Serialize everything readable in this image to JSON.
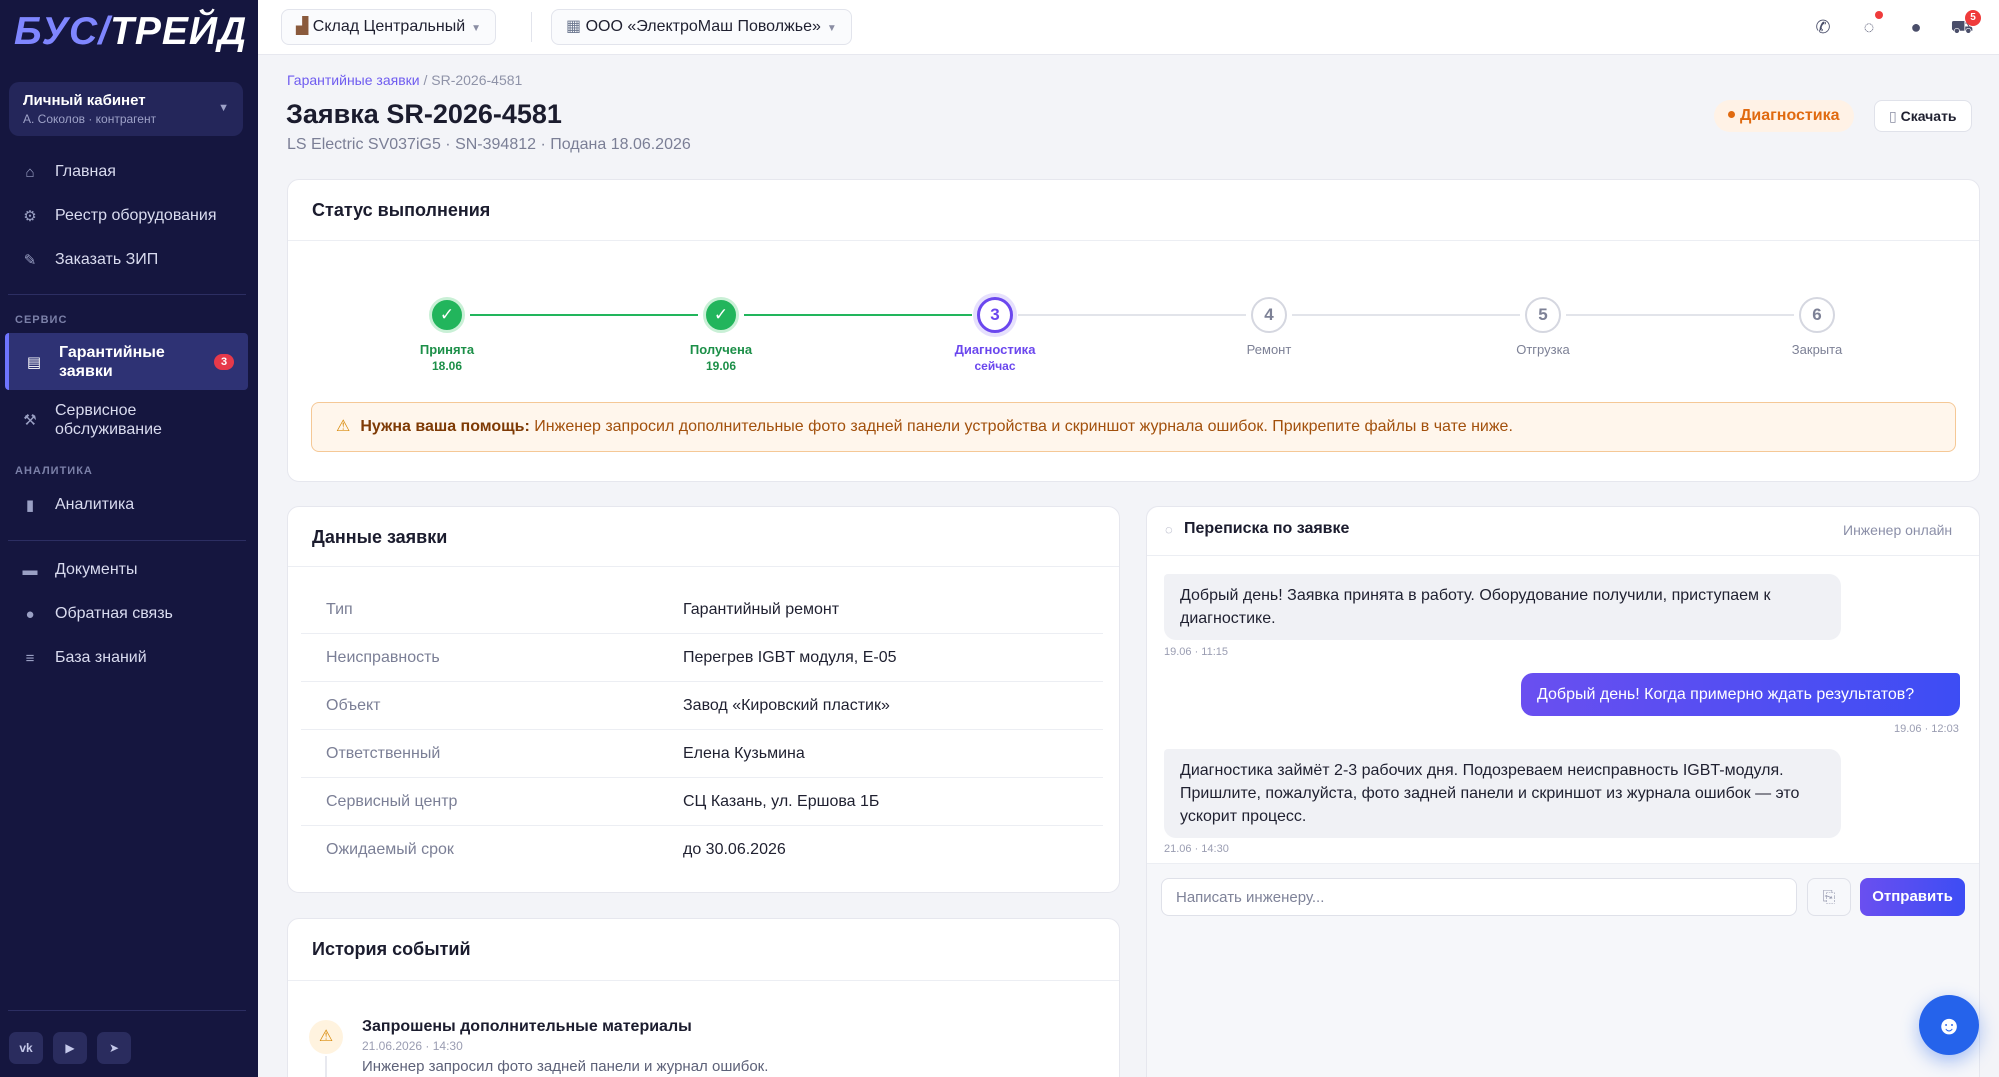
{
  "sidebar": {
    "logo": {
      "part1": "БУС",
      "part2": "ТРЕЙД"
    },
    "cabinet": {
      "title": "Личный кабинет",
      "subtitle": "А. Соколов · контрагент"
    },
    "items_top": [
      {
        "label": "Главная",
        "icon": "home-icon"
      },
      {
        "label": "Реестр оборудования",
        "icon": "gear-icon"
      },
      {
        "label": "Заказать ЗИП",
        "icon": "wrench-icon"
      }
    ],
    "section_service": "СЕРВИС",
    "service_items": [
      {
        "label_1": "Гарантийные",
        "label_2": "заявки",
        "badge": "3",
        "icon": "clipboard-icon"
      },
      {
        "label_1": "Сервисное",
        "label_2": "обслуживание",
        "icon": "tool-icon"
      }
    ],
    "section_analytics": "АНАЛИТИКА",
    "analytics_items": [
      {
        "label": "Аналитика",
        "icon": "chart-icon"
      }
    ],
    "items_bottom": [
      {
        "label": "Документы",
        "icon": "folder-icon"
      },
      {
        "label": "Обратная связь",
        "icon": "chat-icon"
      },
      {
        "label": "База знаний",
        "icon": "books-icon"
      }
    ],
    "social": [
      "vk-icon",
      "youtube-icon",
      "telegram-icon"
    ]
  },
  "topbar": {
    "warehouse": "Склад Центральный",
    "company": "ООО «ЭлектроМаш Поволжье»",
    "cart_count": "5"
  },
  "header": {
    "breadcrumb_link": "Гарантийные заявки",
    "breadcrumb_sep": "/",
    "breadcrumb_current": "SR-2026-4581",
    "title": "Заявка SR-2026-4581",
    "subtitle": "LS Electric SV037iG5 · SN-394812 · Подана 18.06.2026",
    "status": "Диагностика",
    "download": "Скачать"
  },
  "progress": {
    "title": "Статус выполнения",
    "steps": [
      {
        "mark": "✓",
        "label": "Принята",
        "date": "18.06",
        "state": "done"
      },
      {
        "mark": "✓",
        "label": "Получена",
        "date": "19.06",
        "state": "done"
      },
      {
        "mark": "3",
        "label": "Диагностика",
        "date": "сейчас",
        "state": "current"
      },
      {
        "mark": "4",
        "label": "Ремонт",
        "date": "",
        "state": "todo"
      },
      {
        "mark": "5",
        "label": "Отгрузка",
        "date": "",
        "state": "todo"
      },
      {
        "mark": "6",
        "label": "Закрыта",
        "date": "",
        "state": "todo"
      }
    ],
    "alert_strong": "Нужна ваша помощь:",
    "alert_text": "Инженер запросил дополнительные фото задней панели устройства и скриншот журнала ошибок. Прикрепите файлы в чате ниже."
  },
  "details": {
    "title": "Данные заявки",
    "rows": [
      {
        "key": "Тип",
        "value": "Гарантийный ремонт"
      },
      {
        "key": "Неисправность",
        "value": "Перегрев IGBT модуля, E-05"
      },
      {
        "key": "Объект",
        "value": "Завод «Кировский пластик»"
      },
      {
        "key": "Ответственный",
        "value": "Елена Кузьмина"
      },
      {
        "key": "Сервисный центр",
        "value": "СЦ Казань, ул. Ершова 1Б"
      },
      {
        "key": "Ожидаемый срок",
        "value": "до 30.06.2026"
      }
    ]
  },
  "chat": {
    "title": "Переписка по заявке",
    "status": "Инженер онлайн",
    "messages": [
      {
        "dir": "in",
        "text": "Добрый день! Заявка принята в работу. Оборудование получили, приступаем к диагностике.",
        "time": "19.06 · 11:15"
      },
      {
        "dir": "out",
        "text": "Добрый день! Когда примерно ждать результатов?",
        "time": "19.06 · 12:03"
      },
      {
        "dir": "in",
        "text": "Диагностика займёт 2-3 рабочих дня. Подозреваем неисправность IGBT-модуля. Пришлите, пожалуйста, фото задней панели и скриншот из журнала ошибок — это ускорит процесс.",
        "time": "21.06 · 14:30"
      }
    ],
    "input_placeholder": "Написать инженеру...",
    "send": "Отправить"
  },
  "history": {
    "title": "История событий",
    "events": [
      {
        "title": "Запрошены дополнительные материалы",
        "time": "21.06.2026 · 14:30",
        "desc": "Инженер запросил фото задней панели и журнал ошибок."
      }
    ]
  },
  "colors": {
    "accent": "#6b47ee",
    "success": "#22b55c",
    "warning": "#e06a10",
    "sidebar_bg": "#15163f"
  }
}
